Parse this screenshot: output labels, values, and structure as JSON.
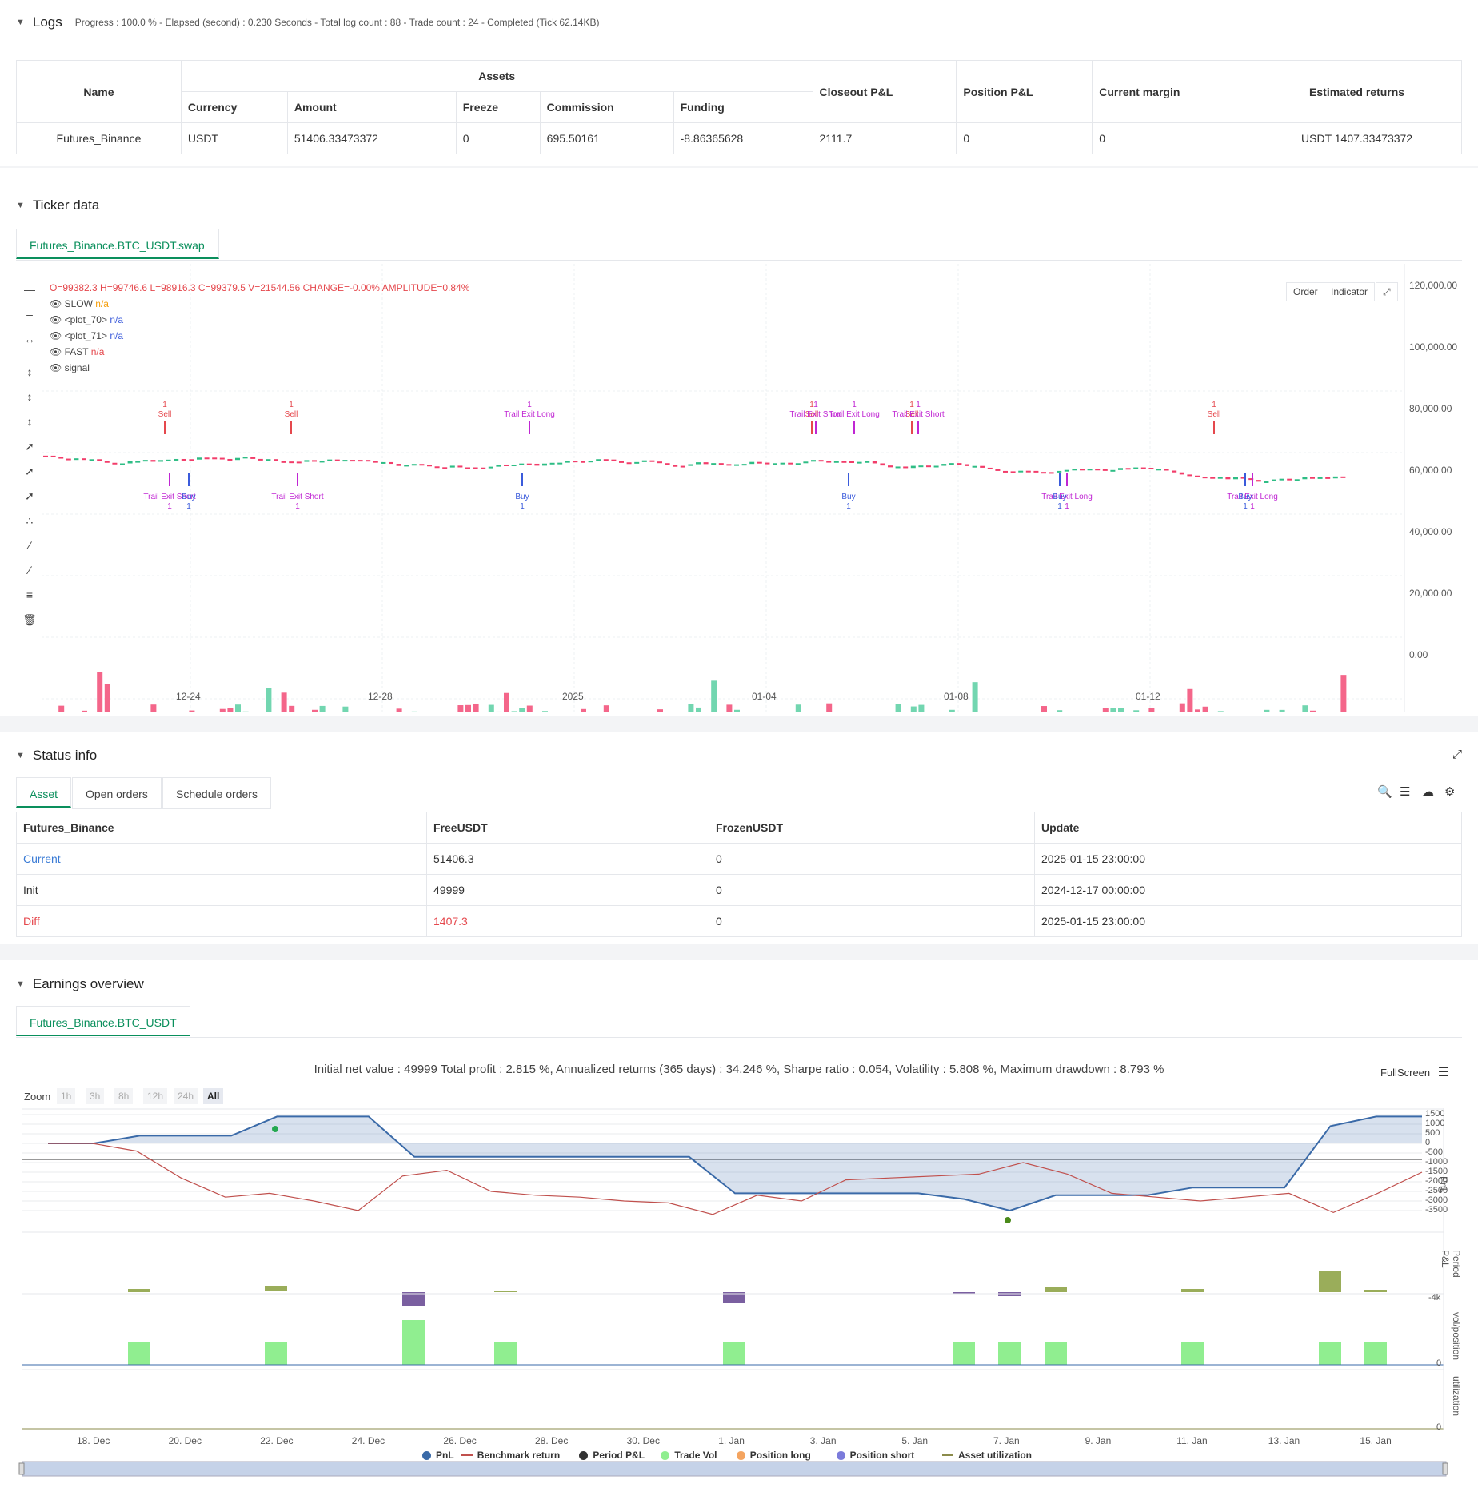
{
  "logs": {
    "title": "Logs",
    "meta": "Progress : 100.0 % - Elapsed (second) : 0.230  Seconds - Total log count : 88 - Trade count : 24 - Completed (Tick 62.14KB)",
    "headers": {
      "name": "Name",
      "assets": "Assets",
      "currency": "Currency",
      "amount": "Amount",
      "freeze": "Freeze",
      "commission": "Commission",
      "funding": "Funding",
      "closeout": "Closeout P&L",
      "position": "Position P&L",
      "margin": "Current margin",
      "returns": "Estimated returns"
    },
    "row": {
      "name": "Futures_Binance",
      "currency": "USDT",
      "amount": "51406.33473372",
      "freeze": "0",
      "commission": "695.50161",
      "funding": "-8.86365628",
      "closeout": "2111.7",
      "position": "0",
      "margin": "0",
      "returns": "USDT 1407.33473372"
    }
  },
  "ticker": {
    "title": "Ticker data",
    "tab": "Futures_Binance.BTC_USDT.swap",
    "ohlc": "O=99382.3  H=99746.6  L=98916.3  C=99379.5  V=21544.56  CHANGE=-0.00%  AMPLITUDE=0.84%",
    "legend": [
      {
        "name": "SLOW",
        "value": "n/a",
        "color": "#f59e0b"
      },
      {
        "name": "<plot_70>",
        "value": "n/a",
        "color": "#3b5bdb"
      },
      {
        "name": "<plot_71>",
        "value": "n/a",
        "color": "#3b5bdb"
      },
      {
        "name": "FAST",
        "value": "n/a",
        "color": "#e5484d"
      },
      {
        "name": "signal",
        "value": "",
        "color": "#444"
      }
    ],
    "order_btn": "Order",
    "indicator_btn": "Indicator",
    "y_ticks": [
      "120,000.00",
      "100,000.00",
      "80,000.00",
      "60,000.00",
      "40,000.00",
      "20,000.00",
      "0.00"
    ],
    "x_ticks": [
      "12-24",
      "12-28",
      "2025",
      "01-04",
      "01-08",
      "01-12"
    ],
    "signals": [
      {
        "label": "Sell",
        "qty": "1",
        "kind": "sell"
      },
      {
        "label": "Trail Exit Short",
        "qty": "1",
        "kind": "exit"
      },
      {
        "label": "Buy",
        "qty": "1",
        "kind": "buy"
      },
      {
        "label": "Sell",
        "qty": "1",
        "kind": "sell"
      },
      {
        "label": "Trail Exit Short",
        "qty": "1",
        "kind": "exit"
      },
      {
        "label": "Trail Exit Long",
        "qty": "1",
        "kind": "exit"
      },
      {
        "label": "Buy",
        "qty": "1",
        "kind": "buy"
      },
      {
        "label": "Sell",
        "qty": "1",
        "kind": "sell"
      },
      {
        "label": "Trail Exit Long",
        "qty": "1",
        "kind": "exit"
      },
      {
        "label": "Trail Exit Short",
        "qty": "1",
        "kind": "exit"
      },
      {
        "label": "Buy",
        "qty": "1",
        "kind": "buy"
      },
      {
        "label": "Sell",
        "qty": "1",
        "kind": "sell"
      },
      {
        "label": "Trail Exit Short",
        "qty": "1",
        "kind": "exit"
      },
      {
        "label": "Trail Exit Long",
        "qty": "1",
        "kind": "exit"
      },
      {
        "label": "Buy",
        "qty": "1",
        "kind": "buy"
      },
      {
        "label": "Sell",
        "qty": "1",
        "kind": "sell"
      },
      {
        "label": "Trail Exit Long",
        "qty": "1",
        "kind": "exit"
      },
      {
        "label": "Buy",
        "qty": "1",
        "kind": "buy"
      }
    ]
  },
  "status": {
    "title": "Status info",
    "tabs": [
      "Asset",
      "Open orders",
      "Schedule orders"
    ],
    "headers": [
      "Futures_Binance",
      "FreeUSDT",
      "FrozenUSDT",
      "Update"
    ],
    "rows": [
      {
        "name": "Current",
        "free": "51406.3",
        "frozen": "0",
        "update": "2025-01-15 23:00:00"
      },
      {
        "name": "Init",
        "free": "49999",
        "frozen": "0",
        "update": "2024-12-17 00:00:00"
      },
      {
        "name": "Diff",
        "free": "1407.3",
        "frozen": "0",
        "update": "2025-01-15 23:00:00"
      }
    ]
  },
  "earnings": {
    "title": "Earnings overview",
    "tab": "Futures_Binance.BTC_USDT",
    "summary": "Initial net value : 49999  Total profit : 2.815 %, Annualized returns (365 days) : 34.246 %, Sharpe ratio : 0.054, Volatility : 5.808 %, Maximum drawdown : 8.793 %",
    "fullscreen": "FullScreen",
    "zoom_label": "Zoom",
    "zoom_options": [
      "1h",
      "3h",
      "8h",
      "12h",
      "24h",
      "All"
    ],
    "pnl_ticks": [
      "1500",
      "1000",
      "500",
      "0",
      "-500",
      "-1000",
      "-1500",
      "-2000",
      "-2500",
      "-3000",
      "-3500"
    ],
    "period_ticks": [
      "0",
      "-4k"
    ],
    "vol_ticks": [
      "0"
    ],
    "util_ticks": [
      "0"
    ],
    "axis_titles": [
      "PnL",
      "Period P&L",
      "vol/position",
      "utilization"
    ],
    "x_ticks": [
      "18. Dec",
      "20. Dec",
      "22. Dec",
      "24. Dec",
      "26. Dec",
      "28. Dec",
      "30. Dec",
      "1. Jan",
      "3. Jan",
      "5. Jan",
      "7. Jan",
      "9. Jan",
      "11. Jan",
      "13. Jan",
      "15. Jan"
    ],
    "legend": [
      {
        "name": "PnL",
        "color": "#3a6aa8",
        "type": "dot"
      },
      {
        "name": "Benchmark return",
        "color": "#c0504d",
        "type": "line"
      },
      {
        "name": "Period P&L",
        "color": "#333333",
        "type": "dot"
      },
      {
        "name": "Trade Vol",
        "color": "#90ee90",
        "type": "dot"
      },
      {
        "name": "Position long",
        "color": "#f4a460",
        "type": "dot"
      },
      {
        "name": "Position short",
        "color": "#7b7bdb",
        "type": "dot"
      },
      {
        "name": "Asset utilization",
        "color": "#8b8b4b",
        "type": "line"
      }
    ],
    "chart_data": {
      "type": "line",
      "title": "",
      "x": [
        "17. Dec",
        "18. Dec",
        "19. Dec",
        "20. Dec",
        "21. Dec",
        "22. Dec",
        "23. Dec",
        "24. Dec",
        "25. Dec",
        "26. Dec",
        "27. Dec",
        "28. Dec",
        "29. Dec",
        "30. Dec",
        "31. Dec",
        "1. Jan",
        "2. Jan",
        "3. Jan",
        "4. Jan",
        "5. Jan",
        "6. Jan",
        "7. Jan",
        "8. Jan",
        "9. Jan",
        "10. Jan",
        "11. Jan",
        "12. Jan",
        "13. Jan",
        "14. Jan",
        "15. Jan",
        "16. Jan"
      ],
      "series": [
        {
          "name": "PnL",
          "values": [
            0,
            0,
            400,
            400,
            400,
            1400,
            1400,
            1400,
            -700,
            -700,
            -700,
            -700,
            -700,
            -700,
            -700,
            -2600,
            -2600,
            -2600,
            -2600,
            -2600,
            -2900,
            -3500,
            -2700,
            -2700,
            -2700,
            -2300,
            -2300,
            -2300,
            900,
            1400,
            1400
          ]
        },
        {
          "name": "Benchmark return",
          "values": [
            0,
            0,
            -400,
            -1800,
            -2800,
            -2600,
            -3000,
            -3500,
            -1700,
            -1400,
            -2500,
            -2700,
            -2800,
            -3000,
            -3100,
            -3700,
            -2700,
            -3000,
            -1900,
            -1800,
            -1700,
            -1600,
            -1000,
            -1600,
            -2600,
            -2800,
            -3000,
            -2800,
            -2600,
            -3600,
            -2600,
            -1500
          ]
        }
      ],
      "ylim": [
        -3500,
        1500
      ]
    }
  }
}
